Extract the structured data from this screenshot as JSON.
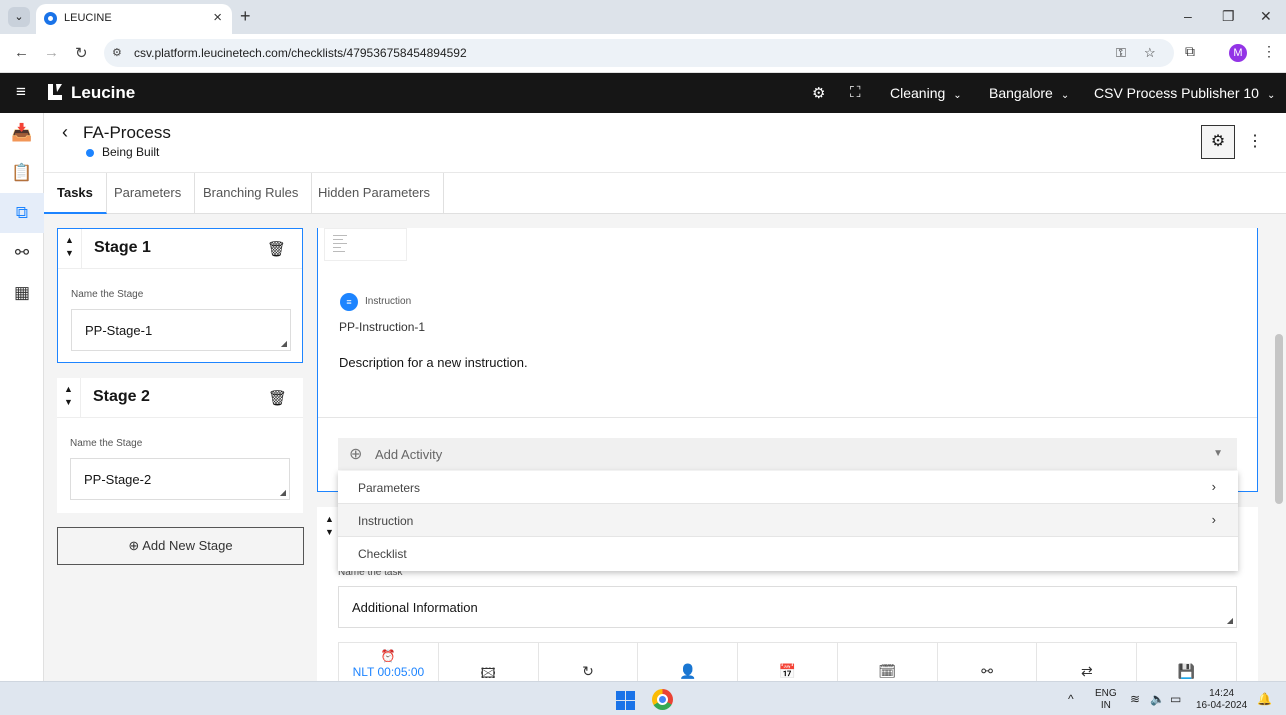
{
  "browser": {
    "tab_title": "LEUCINE",
    "url": "csv.platform.leucinetech.com/checklists/479536758454894592",
    "profile_initial": "M"
  },
  "header": {
    "brand": "Leucine",
    "use_case": "Cleaning",
    "facility": "Bangalore",
    "user_role": "CSV Process Publisher 10"
  },
  "page": {
    "title": "FA-Process",
    "status": "Being Built"
  },
  "tabs": [
    {
      "label": "Tasks",
      "active": true
    },
    {
      "label": "Parameters"
    },
    {
      "label": "Branching Rules"
    },
    {
      "label": "Hidden Parameters"
    }
  ],
  "stages": [
    {
      "title": "Stage 1",
      "name_label": "Name the Stage",
      "name_value": "PP-Stage-1"
    },
    {
      "title": "Stage 2",
      "name_label": "Name the Stage",
      "name_value": "PP-Stage-2"
    }
  ],
  "add_stage_label": "Add New Stage",
  "task": {
    "instruction_type": "Instruction",
    "instruction_name": "PP-Instruction-1",
    "instruction_desc": "Description for a new instruction.",
    "add_activity_label": "Add Activity"
  },
  "activity_menu": [
    {
      "label": "Parameters",
      "has_submenu": true
    },
    {
      "label": "Instruction",
      "has_submenu": true
    },
    {
      "label": "Checklist",
      "has_submenu": false
    }
  ],
  "task2": {
    "name_label": "Name the task",
    "name_value": "Additional Information",
    "timer_label": "NLT 00:05:00"
  },
  "taskbar": {
    "lang_line1": "ENG",
    "lang_line2": "IN",
    "time": "14:24",
    "date": "16-04-2024"
  },
  "colors": {
    "accent": "#1d84ff",
    "header_bg": "#161616"
  }
}
